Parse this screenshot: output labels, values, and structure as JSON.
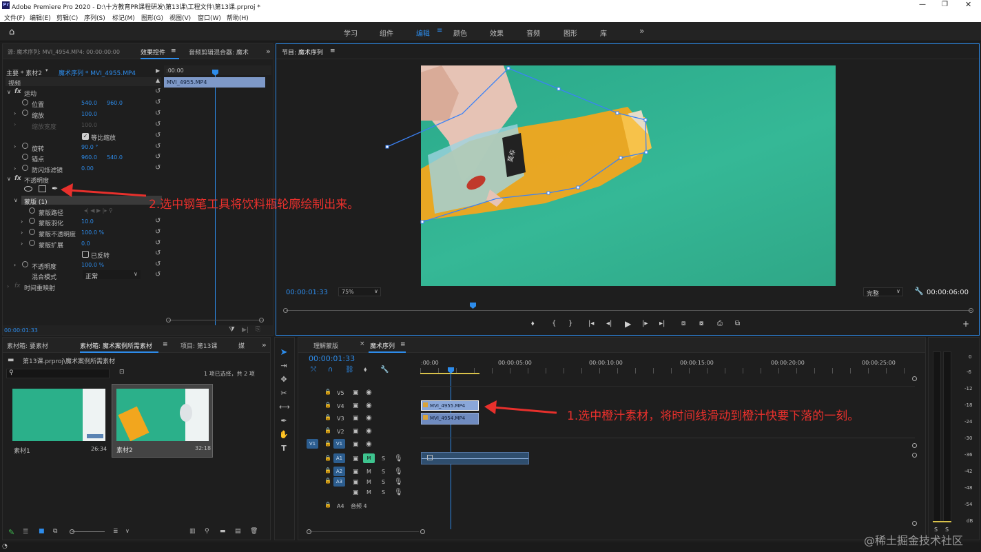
{
  "window": {
    "title": "Adobe Premiere Pro 2020 - D:\\十方教育PR课程研发\\第13课\\工程文件\\第13课.prproj *",
    "app_badge": "Pr"
  },
  "menu": [
    "文件(F)",
    "编辑(E)",
    "剪辑(C)",
    "序列(S)",
    "标记(M)",
    "图形(G)",
    "视图(V)",
    "窗口(W)",
    "帮助(H)"
  ],
  "workspaces": {
    "items": [
      "学习",
      "组件",
      "编辑",
      "颜色",
      "效果",
      "音频",
      "图形",
      "库"
    ],
    "active": "编辑",
    "more": "»"
  },
  "effects_panel": {
    "source_tab": "源: 魔术序列: MVI_4954.MP4: 00:00:00:00",
    "tab_effects": "效果控件",
    "tab_mixer": "音频剪辑混合器: 魔术",
    "master": "主要 * 素材2",
    "seq": "魔术序列 * MVI_4955.MP4",
    "ruler_time": ":00:00",
    "clip_label": "MVI_4955.MP4",
    "video_label": "视频",
    "motion": "运动",
    "position_label": "位置",
    "position_x": "540.0",
    "position_y": "960.0",
    "scale_label": "缩放",
    "scale_val": "100.0",
    "scale_width_label": "缩放宽度",
    "scale_width_val": "100.0",
    "uniform_label": "等比缩放",
    "rotation_label": "旋转",
    "rotation_val": "90.0 °",
    "anchor_label": "锚点",
    "anchor_x": "960.0",
    "anchor_y": "540.0",
    "antiflicker_label": "防闪烁滤镜",
    "antiflicker_val": "0.00",
    "opacity_group": "不透明度",
    "mask_label": "蒙版 (1)",
    "mask_path": "蒙版路径",
    "mask_feather": "蒙版羽化",
    "mask_feather_val": "10.0",
    "mask_opacity": "蒙版不透明度",
    "mask_opacity_val": "100.0 %",
    "mask_expansion": "蒙版扩展",
    "mask_expansion_val": "0.0",
    "inverted_label": "已反转",
    "opacity_label": "不透明度",
    "opacity_val": "100.0 %",
    "blend_label": "混合模式",
    "blend_val": "正常",
    "time_remap": "时间重映射",
    "current_time": "00:00:01:33"
  },
  "program_monitor": {
    "tab": "节目: 魔术序列",
    "timecode": "00:00:01:33",
    "zoom": "75%",
    "quality": "完整",
    "duration": "00:00:06:00",
    "bottle_label": "莫非"
  },
  "project_panel": {
    "tabs": [
      "素材箱: 要素材",
      "素材箱: 魔术案例所需素材",
      "项目: 第13课",
      "媒"
    ],
    "active_tab": "素材箱: 魔术案例所需素材",
    "path": "第13课.prproj\\魔术案例所需素材",
    "selection": "1 项已选择，共 2 项",
    "items": [
      {
        "name": "素材1",
        "duration": "26:34"
      },
      {
        "name": "素材2",
        "duration": "32:18"
      }
    ]
  },
  "timeline": {
    "tabs": [
      "理解蒙版",
      "魔术序列"
    ],
    "active_tab": "魔术序列",
    "timecode": "00:00:01:33",
    "ruler": [
      ":00:00",
      "00:00:05:00",
      "00:00:10:00",
      "00:00:15:00",
      "00:00:20:00",
      "00:00:25:00"
    ],
    "video_tracks": [
      "V5",
      "V4",
      "V3",
      "V2",
      "V1"
    ],
    "audio_tracks": [
      "A1",
      "A2",
      "A3",
      "",
      "A4"
    ],
    "source_v": "V1",
    "audio4_name": "音频 4",
    "clips": [
      {
        "name": "MVI_4955.MP4",
        "track": "V4"
      },
      {
        "name": "MVI_4954.MP4",
        "track": "V3"
      }
    ],
    "meter_ticks": [
      "0",
      "-6",
      "-12",
      "-18",
      "-24",
      "-30",
      "-36",
      "-42",
      "-48",
      "-54",
      "dB"
    ],
    "meter_solo": [
      "S",
      "S"
    ]
  },
  "annotations": {
    "note1": "1.选中橙汁素材，将时间线滑动到橙汁快要下落的一刻。",
    "note2": "2.选中钢笔工具将饮料瓶轮廓绘制出来。"
  },
  "watermark": "@稀土掘金技术社区",
  "colors": {
    "accent": "#2d8ceb",
    "annotation": "#e8302c",
    "green_screen": "#2fb38d",
    "clip": "#6f8bbf"
  }
}
